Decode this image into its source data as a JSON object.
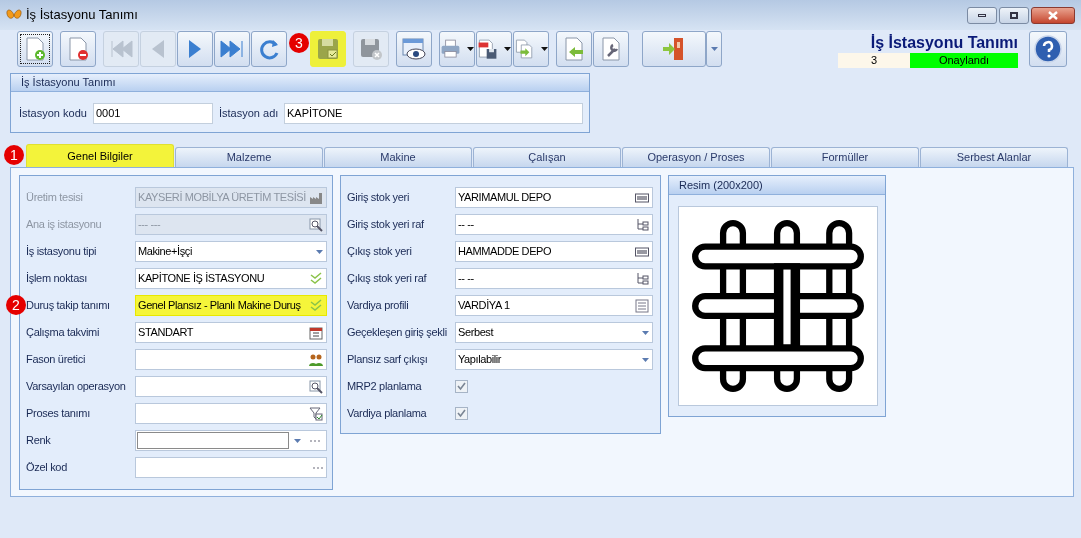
{
  "window": {
    "title": "İş İstasyonu Tanımı"
  },
  "toolbar": [
    {
      "disabled": false,
      "highlighted": false,
      "dropdown": false,
      "focused": true
    },
    {
      "disabled": false,
      "highlighted": false,
      "dropdown": false,
      "focused": false
    },
    {
      "disabled": true,
      "highlighted": false,
      "dropdown": false,
      "focused": false
    },
    {
      "disabled": true,
      "highlighted": false,
      "dropdown": false,
      "focused": false
    },
    {
      "disabled": false,
      "highlighted": false,
      "dropdown": false,
      "focused": false
    },
    {
      "disabled": false,
      "highlighted": false,
      "dropdown": false,
      "focused": false
    },
    {
      "disabled": false,
      "highlighted": false,
      "dropdown": false,
      "focused": false
    },
    {
      "disabled": false,
      "highlighted": true,
      "dropdown": false,
      "focused": false,
      "badge": "3"
    },
    {
      "disabled": true,
      "highlighted": false,
      "dropdown": false,
      "focused": false
    },
    {
      "disabled": false,
      "highlighted": false,
      "dropdown": false,
      "focused": false
    },
    {
      "disabled": false,
      "highlighted": false,
      "dropdown": true,
      "focused": false
    },
    {
      "disabled": false,
      "highlighted": false,
      "dropdown": true,
      "focused": false
    },
    {
      "disabled": false,
      "highlighted": false,
      "dropdown": true,
      "focused": false
    },
    {
      "disabled": false,
      "highlighted": false,
      "dropdown": false,
      "focused": false
    },
    {
      "disabled": false,
      "highlighted": false,
      "dropdown": false,
      "focused": false
    },
    {
      "disabled": false,
      "highlighted": false,
      "dropdown": false,
      "focused": false,
      "split": true
    }
  ],
  "header": {
    "title": "İş İstasyonu Tanımı",
    "number": "3",
    "status": "Onaylandı"
  },
  "station_group": {
    "title": "İş İstasyonu Tanımı",
    "code_label": "İstasyon kodu",
    "code": "0001",
    "name_label": "İstasyon adı",
    "name": "KAPİTONE"
  },
  "tabs": [
    {
      "label": "Genel Bilgiler",
      "selected": true,
      "badge": "1"
    },
    {
      "label": "Malzeme",
      "selected": false
    },
    {
      "label": "Makine",
      "selected": false
    },
    {
      "label": "Çalışan",
      "selected": false
    },
    {
      "label": "Operasyon / Proses",
      "selected": false
    },
    {
      "label": "Formüller",
      "selected": false
    },
    {
      "label": "Serbest Alanlar",
      "selected": false
    }
  ],
  "left_fields": [
    {
      "kind": "lookup",
      "label": "Üretim tesisi",
      "value": "KAYSERİ MOBİLYA ÜRETİM TESİSİ",
      "disabled": true
    },
    {
      "kind": "lookup",
      "label": "Ana iş istasyonu",
      "value": "--- ---",
      "disabled": true
    },
    {
      "kind": "combo",
      "label": "İş istasyonu tipi",
      "value": "Makine+İşçi",
      "disabled": false
    },
    {
      "kind": "lookup",
      "label": "İşlem noktası",
      "value": "KAPİTONE İŞ İSTASYONU",
      "disabled": false
    },
    {
      "kind": "lookup",
      "label": "Duruş takip tanımı",
      "value": "Genel Plansız - Planlı Makine Duruş",
      "disabled": false,
      "highlighted": true,
      "badge": "2"
    },
    {
      "kind": "lookup",
      "label": "Çalışma takvimi",
      "value": "STANDART",
      "disabled": false
    },
    {
      "kind": "lookup",
      "label": "Fason üretici",
      "disabled": false
    },
    {
      "kind": "lookup",
      "label": "Varsayılan operasyon",
      "disabled": false
    },
    {
      "kind": "lookup",
      "label": "Proses tanımı",
      "disabled": false
    },
    {
      "kind": "color",
      "label": "Renk",
      "disabled": false
    },
    {
      "kind": "ellipsis",
      "label": "Özel kod",
      "disabled": false
    }
  ],
  "middle_fields": [
    {
      "kind": "lookup",
      "label": "Giriş stok yeri",
      "value": "YARIMAMUL DEPO"
    },
    {
      "kind": "lookup",
      "label": "Giriş stok yeri raf",
      "value": "-- --"
    },
    {
      "kind": "lookup",
      "label": "Çıkış stok yeri",
      "value": "HAMMADDE DEPO"
    },
    {
      "kind": "lookup",
      "label": "Çıkış stok yeri raf",
      "value": "-- --"
    },
    {
      "kind": "lookup",
      "label": "Vardiya profili",
      "value": "VARDİYA 1"
    },
    {
      "kind": "combo",
      "label": "Geçekleşen giriş şekli",
      "value": "Serbest"
    },
    {
      "kind": "combo",
      "label": "Plansız sarf çıkışı",
      "value": "Yapılabilir"
    },
    {
      "kind": "checkbox",
      "label": "MRP2 planlama",
      "checked": true
    },
    {
      "kind": "checkbox",
      "label": "Vardiya planlama",
      "checked": true
    }
  ],
  "image_group": {
    "title": "Resim (200x200)"
  }
}
